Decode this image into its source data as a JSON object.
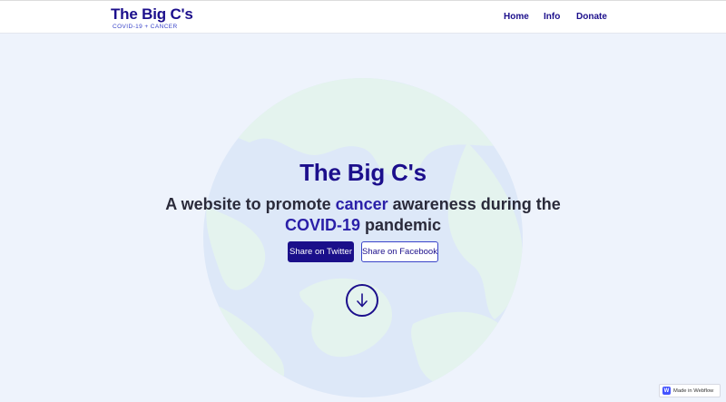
{
  "navbar": {
    "brand_title": "The Big C's",
    "brand_subtitle": "COVID-19 + CANCER",
    "links": [
      "Home",
      "Info",
      "Donate"
    ]
  },
  "hero": {
    "title": "The Big C's",
    "subtitle_parts": [
      "A website to promote ",
      "cancer",
      " awareness during the ",
      "COVID-19",
      " pandemic"
    ],
    "buttons": {
      "twitter": "Share on Twitter",
      "facebook": "Share on Facebook"
    },
    "scroll_icon": "arrow-down-icon"
  },
  "badge": {
    "icon": "webflow-logo-icon",
    "logo_letter": "W",
    "label": "Made in Webflow"
  },
  "colors": {
    "brand": "#1c0f8c",
    "accent": "#3a44c9",
    "background": "#eef3fc",
    "globe_ocean": "#dde8f8",
    "globe_land": "#e4f3ee"
  }
}
